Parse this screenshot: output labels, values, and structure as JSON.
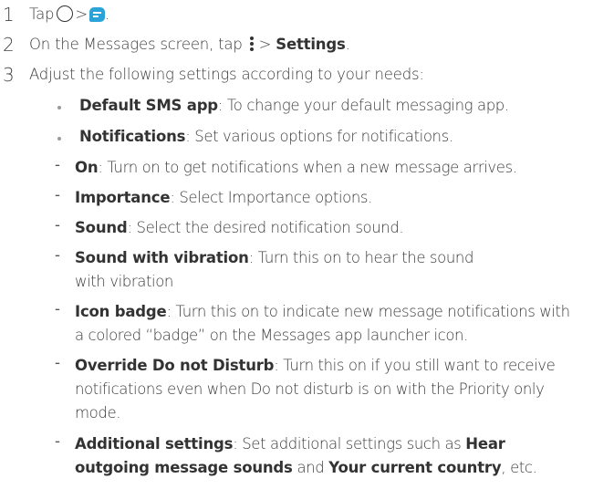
{
  "steps": [
    {
      "num": "1",
      "prefix": "Tap",
      "gt": ">",
      "period": "."
    },
    {
      "num": "2",
      "prefix": "On the Messages screen, tap",
      "gt": ">",
      "bold": "Settings",
      "period": "."
    },
    {
      "num": "3",
      "text": "Adjust the following settings according to your needs:"
    }
  ],
  "bullets": [
    {
      "bold": "Default SMS app",
      "text": ": To change your default messaging app."
    },
    {
      "bold": "Notifications",
      "text": ": Set various options for notifications."
    }
  ],
  "dash": "-",
  "subs": [
    {
      "bold": "On",
      "text": ": Turn on to get notifications when a new message arrives."
    },
    {
      "bold": "Importance",
      "text": ": Select Importance options."
    },
    {
      "bold": "Sound",
      "text": ": Select the desired notification sound."
    },
    {
      "bold": "Sound with vibration",
      "text": ": Turn this on to hear the sound with vibration"
    },
    {
      "bold": "Icon badge",
      "text": ": Turn this on to indicate new message notifications with a colored “badge” on the Messages app launcher icon."
    },
    {
      "bold": "Override Do not Disturb",
      "text": ": Turn this on if you still want to receive notifications even when Do not disturb is on with the Priority only mode."
    },
    {
      "bold": "Additional settings",
      "text": ": Set additional settings such as ",
      "bold2": "Hear outgoing message sounds",
      "text2": " and ",
      "bold3": "Your current country",
      "text3": ", etc."
    }
  ],
  "icons": {
    "home": "home-circle-icon",
    "messages": "messages-app-icon",
    "more": "more-options-icon"
  },
  "colors": {
    "text": "#3a3a3a",
    "messages_icon": "#2aa3d8"
  }
}
